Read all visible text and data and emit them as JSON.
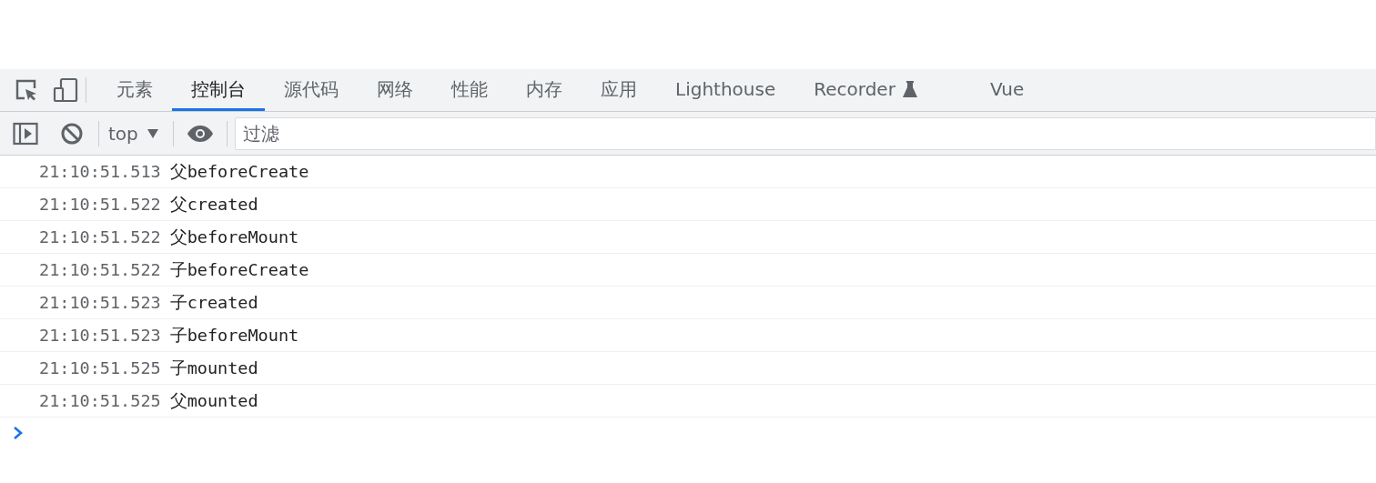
{
  "tabs": [
    {
      "label": "元素",
      "selected": false,
      "experimental": false
    },
    {
      "label": "控制台",
      "selected": true,
      "experimental": false
    },
    {
      "label": "源代码",
      "selected": false,
      "experimental": false
    },
    {
      "label": "网络",
      "selected": false,
      "experimental": false
    },
    {
      "label": "性能",
      "selected": false,
      "experimental": false
    },
    {
      "label": "内存",
      "selected": false,
      "experimental": false
    },
    {
      "label": "应用",
      "selected": false,
      "experimental": false
    },
    {
      "label": "Lighthouse",
      "selected": false,
      "experimental": false
    },
    {
      "label": "Recorder",
      "selected": false,
      "experimental": true
    },
    {
      "label": "Vue",
      "selected": false,
      "experimental": false
    }
  ],
  "toolbar": {
    "context": "top",
    "filter": {
      "placeholder": "过滤"
    }
  },
  "console": {
    "messages": [
      {
        "time": "21:10:51.513",
        "text": "父beforeCreate"
      },
      {
        "time": "21:10:51.522",
        "text": "父created"
      },
      {
        "time": "21:10:51.522",
        "text": "父beforeMount"
      },
      {
        "time": "21:10:51.522",
        "text": "子beforeCreate"
      },
      {
        "time": "21:10:51.523",
        "text": "子created"
      },
      {
        "time": "21:10:51.523",
        "text": "子beforeMount"
      },
      {
        "time": "21:10:51.525",
        "text": "子mounted"
      },
      {
        "time": "21:10:51.525",
        "text": "父mounted"
      }
    ]
  }
}
